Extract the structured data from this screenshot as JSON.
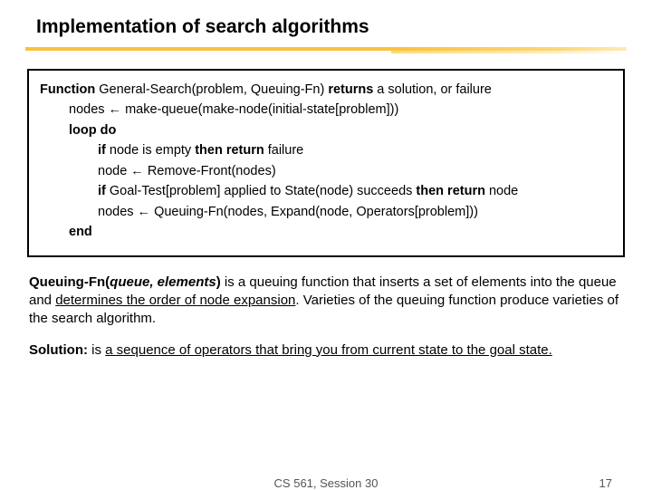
{
  "title": "Implementation of search algorithms",
  "code": {
    "line1_pre": "Function",
    "line1_mid": " General-Search(problem, Queuing-Fn) ",
    "line1_ret": "returns",
    "line1_post": " a solution, or failure",
    "line2": "nodes ← make-queue(make-node(initial-state[problem]))",
    "line3": "loop do",
    "line4_pre": "if",
    "line4_mid": " node is empty ",
    "line4_then": "then return",
    "line4_post": " failure",
    "line5": "node ← Remove-Front(nodes)",
    "line6_pre": "if",
    "line6_mid": " Goal-Test[problem] applied to State(node) succeeds ",
    "line6_then": "then return",
    "line6_post": " node",
    "line7": "nodes ← Queuing-Fn(nodes, Expand(node, Operators[problem]))",
    "line8": "end"
  },
  "para1": {
    "b1": "Queuing-Fn(",
    "bi": "queue, elements",
    "b2": ")",
    "rest1": " is a queuing function that inserts a set of elements into the queue and ",
    "u": "determines the order of node expansion",
    "rest2": ". Varieties of the queuing function produce varieties of the search algorithm."
  },
  "para2": {
    "b": "Solution:",
    "rest1": " is ",
    "u": "a sequence of operators that bring you from current state to the goal state."
  },
  "footer": {
    "center": "CS 561, Session 30",
    "page": "17"
  }
}
